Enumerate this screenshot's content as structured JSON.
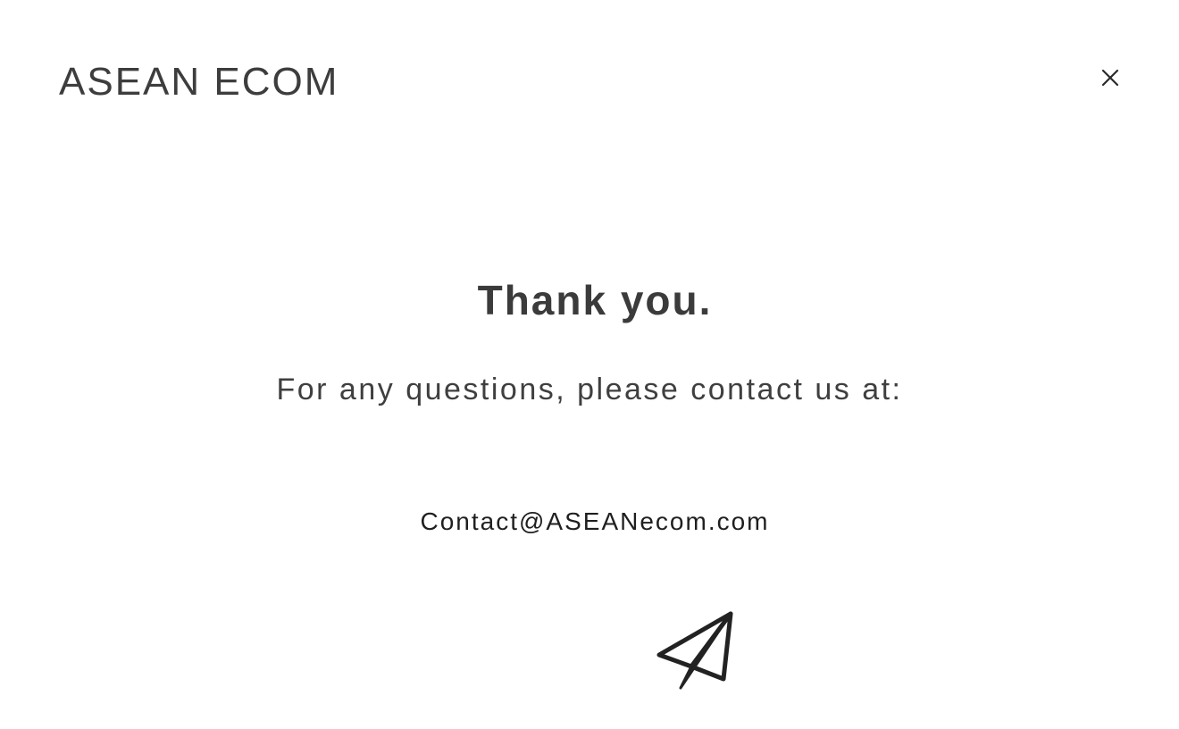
{
  "header": {
    "brand": "ASEAN ECOM",
    "close_icon": "close-icon"
  },
  "main": {
    "title": "Thank you.",
    "subtitle": "For any questions, please contact us at:",
    "email": "Contact@ASEANecom.com",
    "icon": "paper-plane-icon"
  }
}
